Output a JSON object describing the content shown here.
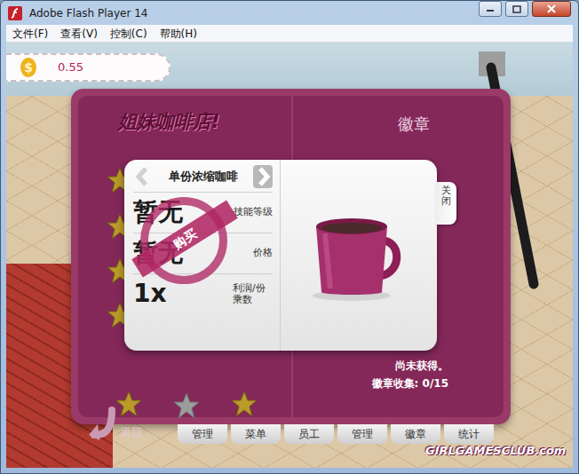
{
  "window": {
    "title": "Adobe Flash Player 14"
  },
  "menu": [
    "文件(F)",
    "查看(V)",
    "控制(C)",
    "帮助(H)"
  ],
  "money": {
    "symbol": "$",
    "amount": "0.55"
  },
  "book": {
    "logo": "姐妹咖啡店!",
    "page_title": "徽章",
    "status": "尚未获得。",
    "collected": "徽章收集: 0/15",
    "back": "返回"
  },
  "badge_stars": [
    {
      "earned": true
    },
    {
      "earned": true
    },
    {
      "earned": true
    },
    {
      "earned": true
    },
    {
      "earned": true
    },
    {
      "earned": false
    },
    {
      "earned": true
    }
  ],
  "item_card": {
    "name": "单份浓缩咖啡",
    "stamp": "购买",
    "close": "关闭",
    "stats": [
      {
        "value": "暂无",
        "label": "技能等级"
      },
      {
        "value": "暂无",
        "label": "价格"
      },
      {
        "value": "1x",
        "label": "利润/份乘数"
      }
    ]
  },
  "tabs": [
    {
      "label": "管理",
      "selected": false
    },
    {
      "label": "菜单",
      "selected": false
    },
    {
      "label": "员工",
      "selected": false
    },
    {
      "label": "管理",
      "selected": false
    },
    {
      "label": "徽章",
      "selected": false
    },
    {
      "label": "统计",
      "selected": false
    }
  ],
  "site_logo": "GIRLGAMESCLUB.com"
}
